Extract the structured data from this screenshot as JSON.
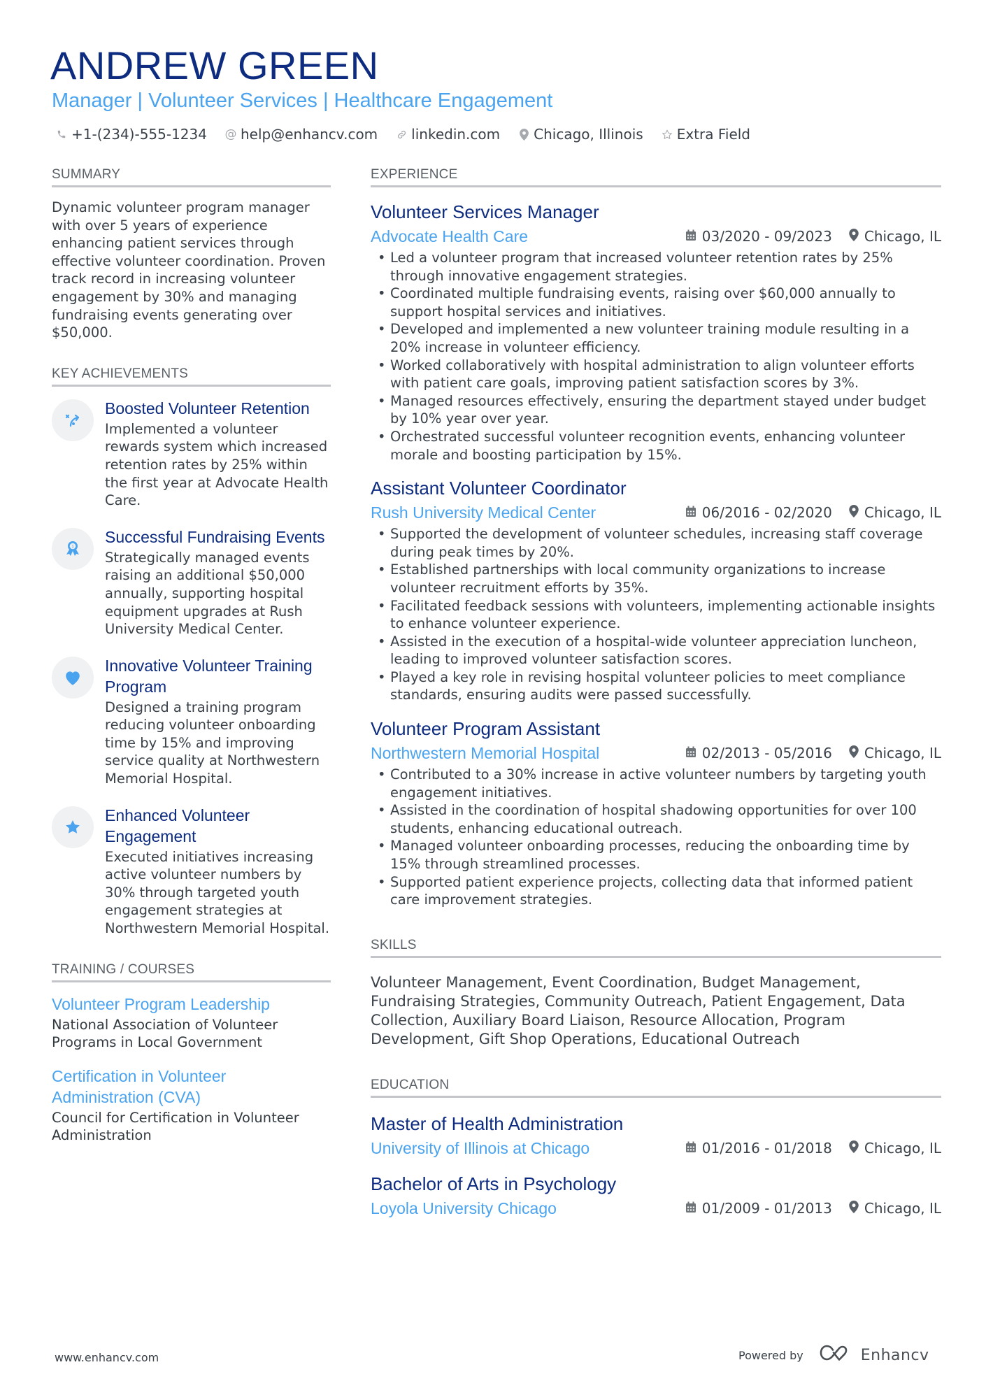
{
  "header": {
    "name": "ANDREW GREEN",
    "title": "Manager | Volunteer Services | Healthcare Engagement",
    "contacts": [
      {
        "icon": "phone-icon",
        "text": "+1-(234)-555-1234"
      },
      {
        "icon": "at-icon",
        "text": "help@enhancv.com"
      },
      {
        "icon": "link-icon",
        "text": "linkedin.com"
      },
      {
        "icon": "location-pin-icon",
        "text": "Chicago, Illinois"
      },
      {
        "icon": "star-outline-icon",
        "text": "Extra Field"
      }
    ]
  },
  "summary": {
    "heading": "SUMMARY",
    "text": "Dynamic volunteer program manager with over 5 years of experience enhancing patient services through effective volunteer coordination. Proven track record in increasing volunteer engagement by 30% and managing fundraising events generating over $50,000."
  },
  "achievements": {
    "heading": "KEY ACHIEVEMENTS",
    "items": [
      {
        "icon": "route-arrow-icon",
        "title": "Boosted Volunteer Retention",
        "desc": "Implemented a volunteer rewards system which increased retention rates by 25% within the first year at Advocate Health Care."
      },
      {
        "icon": "award-ribbon-icon",
        "title": "Successful Fundraising Events",
        "desc": "Strategically managed events raising an additional $50,000 annually, supporting hospital equipment upgrades at Rush University Medical Center."
      },
      {
        "icon": "heart-icon",
        "title": "Innovative Volunteer Training Program",
        "desc": "Designed a training program reducing volunteer onboarding time by 15% and improving service quality at Northwestern Memorial Hospital."
      },
      {
        "icon": "star-icon",
        "title": "Enhanced Volunteer Engagement",
        "desc": "Executed initiatives increasing active volunteer numbers by 30% through targeted youth engagement strategies at Northwestern Memorial Hospital."
      }
    ]
  },
  "training": {
    "heading": "TRAINING / COURSES",
    "items": [
      {
        "title": "Volunteer Program Leadership",
        "desc": "National Association of Volunteer Programs in Local Government"
      },
      {
        "title": "Certification in Volunteer Administration (CVA)",
        "desc": "Council for Certification in Volunteer Administration"
      }
    ]
  },
  "experience": {
    "heading": "EXPERIENCE",
    "jobs": [
      {
        "title": "Volunteer Services Manager",
        "company": "Advocate Health Care",
        "dates": "03/2020 - 09/2023",
        "location": "Chicago, IL",
        "bullets": [
          "Led a volunteer program that increased volunteer retention rates by 25% through innovative engagement strategies.",
          "Coordinated multiple fundraising events, raising over $60,000 annually to support hospital services and initiatives.",
          "Developed and implemented a new volunteer training module resulting in a 20% increase in volunteer efficiency.",
          "Worked collaboratively with hospital administration to align volunteer efforts with patient care goals, improving patient satisfaction scores by 3%.",
          "Managed resources effectively, ensuring the department stayed under budget by 10% year over year.",
          "Orchestrated successful volunteer recognition events, enhancing volunteer morale and boosting participation by 15%."
        ]
      },
      {
        "title": "Assistant Volunteer Coordinator",
        "company": "Rush University Medical Center",
        "dates": "06/2016 - 02/2020",
        "location": "Chicago, IL",
        "bullets": [
          "Supported the development of volunteer schedules, increasing staff coverage during peak times by 20%.",
          "Established partnerships with local community organizations to increase volunteer recruitment efforts by 35%.",
          "Facilitated feedback sessions with volunteers, implementing actionable insights to enhance volunteer experience.",
          "Assisted in the execution of a hospital-wide volunteer appreciation luncheon, leading to improved volunteer satisfaction scores.",
          "Played a key role in revising hospital volunteer policies to meet compliance standards, ensuring audits were passed successfully."
        ]
      },
      {
        "title": "Volunteer Program Assistant",
        "company": "Northwestern Memorial Hospital",
        "dates": "02/2013 - 05/2016",
        "location": "Chicago, IL",
        "bullets": [
          "Contributed to a 30% increase in active volunteer numbers by targeting youth engagement initiatives.",
          "Assisted in the coordination of hospital shadowing opportunities for over 100 students, enhancing educational outreach.",
          "Managed volunteer onboarding processes, reducing the onboarding time by 15% through streamlined processes.",
          "Supported patient experience projects, collecting data that informed patient care improvement strategies."
        ]
      }
    ]
  },
  "skills": {
    "heading": "SKILLS",
    "text": "Volunteer Management, Event Coordination, Budget Management, Fundraising Strategies, Community Outreach, Patient Engagement, Data Collection, Auxiliary Board Liaison, Resource Allocation, Program Development, Gift Shop Operations, Educational Outreach"
  },
  "education": {
    "heading": "EDUCATION",
    "items": [
      {
        "degree": "Master of Health Administration",
        "school": "University of Illinois at Chicago",
        "dates": "01/2016 - 01/2018",
        "location": "Chicago, IL"
      },
      {
        "degree": "Bachelor of Arts in Psychology",
        "school": "Loyola University Chicago",
        "dates": "01/2009 - 01/2013",
        "location": "Chicago, IL"
      }
    ]
  },
  "footer": {
    "website": "www.enhancv.com",
    "powered_by": "Powered by",
    "brand": "Enhancv"
  },
  "colors": {
    "name": "#0d2c80",
    "accent": "#4aa3ef",
    "text": "#3a4149",
    "rule": "#c3c5c8",
    "icon_bg": "#f0f1f2"
  }
}
